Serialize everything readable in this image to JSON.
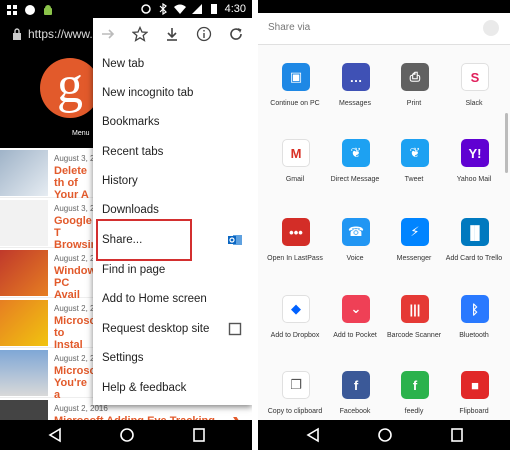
{
  "left_phone": {
    "status_bar": {
      "time": "4:30"
    },
    "url_bar": {
      "url": "https://www.gr"
    },
    "site": {
      "logo_letter": "g",
      "menu_label": "Menu"
    },
    "articles": [
      {
        "date": "August 3, 2",
        "title": "Delete th of Your A"
      },
      {
        "date": "August 3, 2",
        "title": "Google T Browsin"
      },
      {
        "date": "August 2, 2",
        "title": "Window PC Avail"
      },
      {
        "date": "August 2, 2",
        "title": "Microso to Instal"
      },
      {
        "date": "August 2, 2",
        "title": "Microso You're a"
      },
      {
        "date": "August 2, 2016",
        "title": "Microsoft Adding Eye Tracking Technology to Windows 10"
      }
    ],
    "menu": {
      "items": [
        {
          "label": "New tab"
        },
        {
          "label": "New incognito tab"
        },
        {
          "label": "Bookmarks"
        },
        {
          "label": "Recent tabs"
        },
        {
          "label": "History"
        },
        {
          "label": "Downloads"
        },
        {
          "label": "Share..."
        },
        {
          "label": "Find in page"
        },
        {
          "label": "Add to Home screen"
        },
        {
          "label": "Request desktop site"
        },
        {
          "label": "Settings"
        },
        {
          "label": "Help & feedback"
        }
      ]
    }
  },
  "right_phone": {
    "share_sheet": {
      "title": "Share via",
      "apps": [
        {
          "label": "Continue on PC",
          "icon": "continue-on-pc-icon",
          "color": "#1e88e5"
        },
        {
          "label": "Messages",
          "icon": "messages-icon",
          "color": "#3f51b5"
        },
        {
          "label": "Print",
          "icon": "printer-icon",
          "color": "#616161"
        },
        {
          "label": "Slack",
          "icon": "slack-icon",
          "color": "#ffffff"
        },
        {
          "label": "Gmail",
          "icon": "gmail-icon",
          "color": "#ffffff"
        },
        {
          "label": "Direct Message",
          "icon": "twitter-icon",
          "color": "#1da1f2"
        },
        {
          "label": "Tweet",
          "icon": "twitter-icon",
          "color": "#1da1f2"
        },
        {
          "label": "Yahoo Mail",
          "icon": "yahoo-mail-icon",
          "color": "#6001d2"
        },
        {
          "label": "Open In LastPass",
          "icon": "lastpass-icon",
          "color": "#d32d27"
        },
        {
          "label": "Voice",
          "icon": "phone-icon",
          "color": "#2196f3"
        },
        {
          "label": "Messenger",
          "icon": "messenger-icon",
          "color": "#0084ff"
        },
        {
          "label": "Add Card to Trello",
          "icon": "trello-icon",
          "color": "#0079bf"
        },
        {
          "label": "Add to Dropbox",
          "icon": "dropbox-icon",
          "color": "#ffffff"
        },
        {
          "label": "Add to Pocket",
          "icon": "pocket-icon",
          "color": "#ef4056"
        },
        {
          "label": "Barcode Scanner",
          "icon": "barcode-icon",
          "color": "#e53935"
        },
        {
          "label": "Bluetooth",
          "icon": "bluetooth-icon",
          "color": "#2979ff"
        },
        {
          "label": "Copy to clipboard",
          "icon": "clipboard-icon",
          "color": "#ffffff"
        },
        {
          "label": "Facebook",
          "icon": "facebook-icon",
          "color": "#3b5998"
        },
        {
          "label": "feedly",
          "icon": "feedly-icon",
          "color": "#2bb24c"
        },
        {
          "label": "Flipboard",
          "icon": "flipboard-icon",
          "color": "#e12828"
        }
      ]
    }
  }
}
